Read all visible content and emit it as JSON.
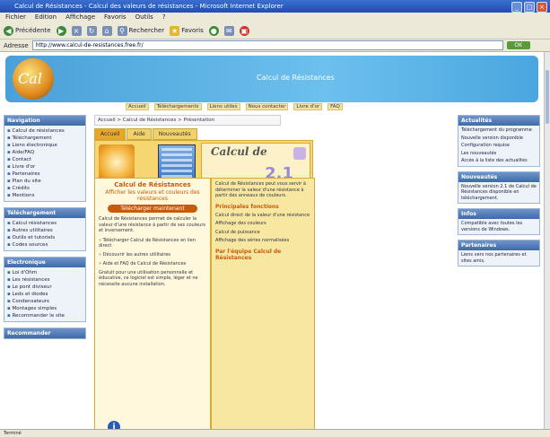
{
  "window": {
    "title": "Calcul de Résistances - Calcul des valeurs de résistances - Microsoft Internet Explorer"
  },
  "menu": [
    "Fichier",
    "Edition",
    "Affichage",
    "Favoris",
    "Outils",
    "?"
  ],
  "toolbar": {
    "back": "Précédente",
    "search": "Rechercher",
    "favorites": "Favoris"
  },
  "address": {
    "label": "Adresse",
    "url": "http://www.calcul-de-resistances.free.fr/",
    "go": "OK"
  },
  "site": {
    "banner_text": "Calcul de Résistances",
    "logo_text": "Cal"
  },
  "nav": [
    "Accueil",
    "Téléchargements",
    "Liens utiles",
    "Nous contacter",
    "Livre d'or",
    "FAQ"
  ],
  "left": {
    "box1": {
      "title": "Navigation",
      "items": [
        "Calcul de résistances",
        "Téléchargement",
        "Liens électronique",
        "Aide/FAQ",
        "Contact",
        "Livre d'or",
        "Partenaires",
        "Plan du site",
        "Crédits",
        "Mentions"
      ]
    },
    "box2": {
      "title": "Téléchargement",
      "items": [
        "Calcul résistances",
        "Autres utilitaires",
        "Outils et tutoriels",
        "Codes sources"
      ]
    },
    "box3": {
      "title": "Electronique",
      "items": [
        "Loi d'Ohm",
        "Les résistances",
        "Le pont diviseur",
        "Leds et diodes",
        "Condensateurs",
        "Montages simples",
        "Recommander le site"
      ]
    },
    "box4": {
      "title": "Recommander"
    }
  },
  "content": {
    "breadcrumb": "Accueil > Calcul de Résistances > Présentation",
    "tabs": [
      "Accueil",
      "Aide",
      "Nouveautés"
    ],
    "calc_title": "Calcul de",
    "version": "2.1",
    "left_title": "Calcul de Résistances",
    "left_sub": "Afficher les valeurs et couleurs des résistances",
    "download": "Télécharger maintenant",
    "para1": "Calcul de Résistances permet de calculer la valeur d'une résistance à partir de ses couleurs et inversement.",
    "bullets": [
      "Télécharger Calcul de Résistances en lien direct",
      "Découvrir les autres utilitaires",
      "Aide et FAQ de Calcul de Résistances"
    ],
    "para2": "Gratuit pour une utilisation personnelle et éducative, ce logiciel est simple, léger et ne nécessite aucune installation.",
    "right_intro": "Calcul de Résistances peut vous servir à déterminer la valeur d'une résistance à partir des anneaux de couleurs.",
    "right_head": "Principales fonctions",
    "right_items": [
      "Calcul direct de la valeur d'une résistance",
      "Affichage des couleurs",
      "Calcul de puissance",
      "Affichage des séries normalisées"
    ],
    "right_tail": "Par l'équipe Calcul de Résistances"
  },
  "right": {
    "box1": {
      "title": "Actualités",
      "items": [
        "Téléchargement du programme",
        "Nouvelle version disponible",
        "Configuration requise",
        "Les nouveautés",
        "Accès à la liste des actualités"
      ]
    },
    "box2": {
      "title": "Nouveautés",
      "text": "Nouvelle version 2.1 de Calcul de Résistances disponible en téléchargement."
    },
    "box3": {
      "title": "Infos",
      "text": "Compatible avec toutes les versions de Windows."
    },
    "box4": {
      "title": "Partenaires",
      "text": "Liens vers nos partenaires et sites amis."
    }
  },
  "status": "Terminé"
}
